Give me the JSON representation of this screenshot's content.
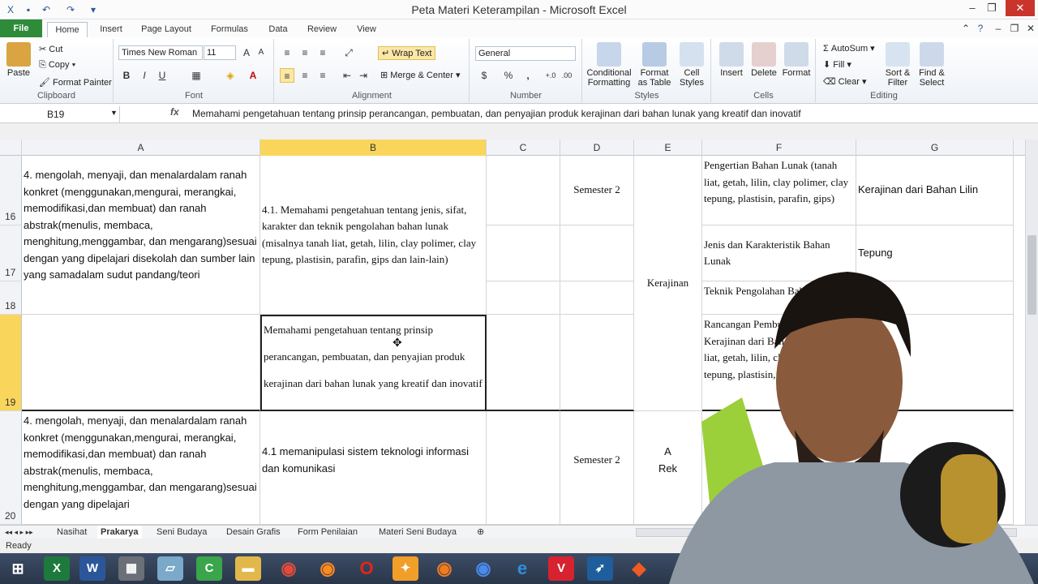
{
  "window": {
    "title": "Peta Materi Keterampilan - Microsoft Excel"
  },
  "tabs": [
    "File",
    "Home",
    "Insert",
    "Page Layout",
    "Formulas",
    "Data",
    "Review",
    "View"
  ],
  "clipboard": {
    "paste": "Paste",
    "cut": "Cut",
    "copy": "Copy",
    "format_painter": "Format Painter",
    "label": "Clipboard"
  },
  "font": {
    "name": "Times New Roman",
    "size": "11",
    "bold": "B",
    "italic": "I",
    "underline": "U",
    "label": "Font"
  },
  "alignment": {
    "wrap": "Wrap Text",
    "merge": "Merge & Center",
    "label": "Alignment"
  },
  "number": {
    "format": "General",
    "currency": "$",
    "percent": "%",
    "comma": ",",
    "label": "Number"
  },
  "styles": {
    "conditional": "Conditional Formatting",
    "format_table": "Format as Table",
    "cell_styles": "Cell Styles",
    "label": "Styles"
  },
  "cells": {
    "insert": "Insert",
    "delete": "Delete",
    "format": "Format",
    "label": "Cells"
  },
  "editing": {
    "autosum": "AutoSum",
    "fill": "Fill",
    "clear": "Clear",
    "sort": "Sort & Filter",
    "find": "Find & Select",
    "label": "Editing"
  },
  "formula_bar": {
    "name_box": "B19",
    "fx": "fx",
    "content": "Memahami pengetahuan tentang prinsip perancangan, pembuatan, dan penyajian produk kerajinan dari bahan lunak yang kreatif dan inovatif"
  },
  "columns": [
    "A",
    "B",
    "C",
    "D",
    "E",
    "F",
    "G"
  ],
  "rows": {
    "r16": "16",
    "r17": "17",
    "r18": "18",
    "r19": "19",
    "r20": "20"
  },
  "cells_data": {
    "a16": "4. mengolah, menyaji, dan menalardalam ranah konkret (menggunakan,mengurai, merangkai, memodifikasi,dan membuat) dan ranah abstrak(menulis, membaca, menghitung,menggambar, dan mengarang)sesuai dengan yang dipelajari disekolah dan sumber lain yang samadalam sudut pandang/teori",
    "b16": "4.1. Memahami pengetahuan tentang jenis, sifat, karakter dan teknik pengolahan bahan lunak (misalnya tanah liat, getah, lilin, clay polimer, clay tepung, plastisin, parafin, gips dan lain-lain)",
    "d16": "Semester 2",
    "e16": "Kerajinan",
    "f16": "Pengertian Bahan Lunak (tanah liat, getah, lilin, clay polimer, clay tepung, plastisin, parafin, gips)",
    "g16": "Kerajinan dari Bahan Lilin",
    "f17": "Jenis dan Karakteristik Bahan Lunak",
    "g17": "Tepung",
    "f18": "Teknik Pengolahan Bahan Lunak",
    "b19": "Memahami pengetahuan tentang prinsip perancangan, pembuatan, dan penyajian produk kerajinan dari bahan lunak yang kreatif dan inovatif",
    "f19": "Rancangan Pembuatan Produk Kerajinan dari Bahan Lunak (tanah liat, getah, lilin, clay polimer, clay tepung, plastisin, parafin, gips)",
    "a20": "4. mengolah, menyaji, dan menalardalam ranah konkret (menggunakan,mengurai, merangkai, memodifikasi,dan membuat) dan ranah abstrak(menulis, membaca, menghitung,menggambar, dan mengarang)sesuai dengan yang dipelajari",
    "b20": "4.1 memanipulasi sistem teknologi informasi dan komunikasi",
    "d20": "Semester 2",
    "e20": "A\nRek"
  },
  "sheet_tabs": [
    "Nasihat",
    "Prakarya",
    "Seni Budaya",
    "Desain Grafis",
    "Form Penilaian",
    "Materi Seni Budaya"
  ],
  "active_sheet": "Prakarya",
  "status": "Ready",
  "colors": {
    "file_tab": "#2e8b3a",
    "selected_header": "#f9d65b",
    "taskbar": "#2a3649"
  }
}
